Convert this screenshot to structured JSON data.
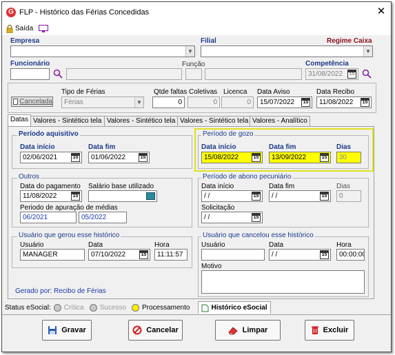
{
  "window": {
    "title": "FLP - Histórico das Férias Concedidas",
    "logo_letter": "G",
    "close": "✕"
  },
  "toolbar": {
    "exit_label": "Saída"
  },
  "header": {
    "empresa_label": "Empresa",
    "filial_label": "Filial",
    "regime_caixa_label": "Regime Caixa",
    "funcionario_label": "Funcionário",
    "funcao_label": "Função",
    "competencia_label": "Competência",
    "competencia_value": "31/08/2022"
  },
  "info_row": {
    "cancelada_label": "Cancelada",
    "tipo_ferias_label": "Tipo de Férias",
    "tipo_ferias_value": "Férias",
    "qtde_faltas_label": "Qtde faltas",
    "qtde_faltas_value": "0",
    "coletivas_label": "Coletivas",
    "coletivas_value": "0",
    "licenca_label": "Licenca",
    "licenca_value": "0",
    "data_aviso_label": "Data Aviso",
    "data_aviso_value": "15/07/2022",
    "data_recibo_label": "Data Recibo",
    "data_recibo_value": "11/08/2022"
  },
  "tabs": [
    {
      "label": "Datas"
    },
    {
      "label": "Valores - Sintético tela 1"
    },
    {
      "label": "Valores - Sintético tela 2"
    },
    {
      "label": "Valores - Sintético tela 3"
    },
    {
      "label": "Valores - Analítico"
    }
  ],
  "periodo_aquisitivo": {
    "title": "Período aquisitivo",
    "inicio_label": "Data início",
    "inicio_value": "02/06/2021",
    "fim_label": "Data fim",
    "fim_value": "01/06/2022"
  },
  "periodo_gozo": {
    "title": "Período de gozo",
    "inicio_label": "Data início",
    "inicio_value": "15/08/2022",
    "fim_label": "Data fim",
    "fim_value": "13/09/2022",
    "dias_label": "Dias",
    "dias_value": "30"
  },
  "outros": {
    "title": "Outros",
    "pagamento_label": "Data do pagamento",
    "pagamento_value": "11/08/2022",
    "salario_label": "Salário base utilizado",
    "apuracao_label": "Periodo de apuração de médias",
    "apuracao_inicio": "06/2021",
    "apuracao_fim": "05/2022"
  },
  "abono": {
    "title": "Período de abono pecuniário",
    "inicio_label": "Data início",
    "inicio_value": "/ /",
    "fim_label": "Data fim",
    "fim_value": "/ /",
    "dias_label": "Dias",
    "dias_value": "0",
    "solicitacao_label": "Solicitação",
    "solicitacao_value": "/ /"
  },
  "gerou": {
    "title": "Usuário que gerou esse histórico",
    "usuario_label": "Usuário",
    "usuario_value": "MANAGER",
    "data_label": "Data",
    "data_value": "07/10/2022",
    "hora_label": "Hora",
    "hora_value": "11:11:57",
    "gerado_por": "Gerado por: Recibo de Férias"
  },
  "cancelou": {
    "title": "Usuário que cancelou esse histórico",
    "usuario_label": "Usuário",
    "usuario_value": "",
    "data_label": "Data",
    "data_value": "/ /",
    "hora_label": "Hora",
    "hora_value": "00:00:00",
    "motivo_label": "Motivo"
  },
  "status": {
    "label": "Status eSocial:",
    "items": [
      {
        "label": "Crítica",
        "color": "#c8c8c8"
      },
      {
        "label": "Sucesso",
        "color": "#c8c8c8"
      },
      {
        "label": "Processamento",
        "color": "#ffee00"
      }
    ],
    "historico_tab": "Histórico eSocial"
  },
  "buttons": {
    "gravar": "Gravar",
    "cancelar": "Cancelar",
    "limpar": "Limpar",
    "excluir": "Excluir"
  },
  "colors": {
    "label_blue": "#1a3a8a",
    "regime_red": "#8b0d1a",
    "highlight_yellow": "#ffff00",
    "highlight_border": "#e0e020",
    "gerado_blue": "#1a3aaa"
  },
  "calendar_glyph": "15"
}
